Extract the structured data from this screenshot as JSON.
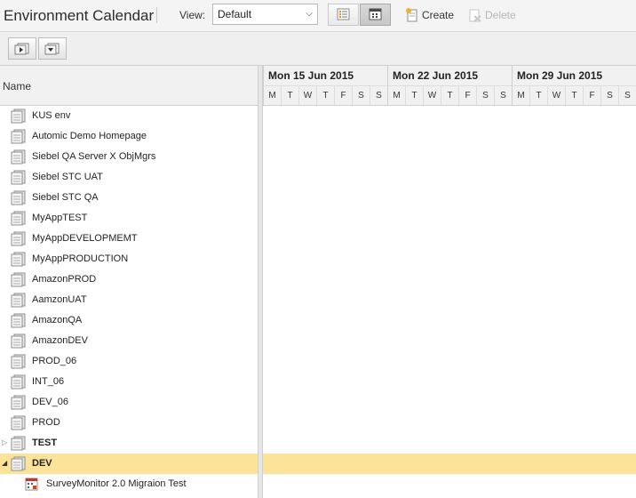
{
  "app": {
    "title": "Environment Calendar"
  },
  "toolbar": {
    "view_label": "View:",
    "view_select": "Default",
    "create_label": "Create",
    "delete_label": "Delete"
  },
  "tree": {
    "header": "Name",
    "items": [
      {
        "label": "KUS env"
      },
      {
        "label": "Automic Demo Homepage"
      },
      {
        "label": "Siebel QA Server X ObjMgrs"
      },
      {
        "label": "Siebel STC UAT"
      },
      {
        "label": "Siebel STC QA"
      },
      {
        "label": "MyAppTEST"
      },
      {
        "label": "MyAppDEVELOPMEMT"
      },
      {
        "label": "MyAppPRODUCTION"
      },
      {
        "label": "AmazonPROD"
      },
      {
        "label": "AamzonUAT"
      },
      {
        "label": "AmazonQA"
      },
      {
        "label": "AmazonDEV"
      },
      {
        "label": "PROD_06"
      },
      {
        "label": "INT_06"
      },
      {
        "label": "DEV_06"
      },
      {
        "label": "PROD"
      },
      {
        "label": "TEST"
      },
      {
        "label": "DEV"
      },
      {
        "label": "SurveyMonitor 2.0 Migraion Test"
      }
    ]
  },
  "calendar": {
    "weeks": [
      {
        "label": "Mon 15 Jun 2015",
        "days": [
          "M",
          "T",
          "W",
          "T",
          "F",
          "S",
          "S"
        ]
      },
      {
        "label": "Mon 22 Jun 2015",
        "days": [
          "M",
          "T",
          "W",
          "T",
          "F",
          "S",
          "S"
        ]
      },
      {
        "label": "Mon 29 Jun 2015",
        "days": [
          "M",
          "T",
          "W",
          "T",
          "F",
          "S",
          "S"
        ]
      }
    ]
  },
  "colors": {
    "selected_row": "#fce39a"
  }
}
